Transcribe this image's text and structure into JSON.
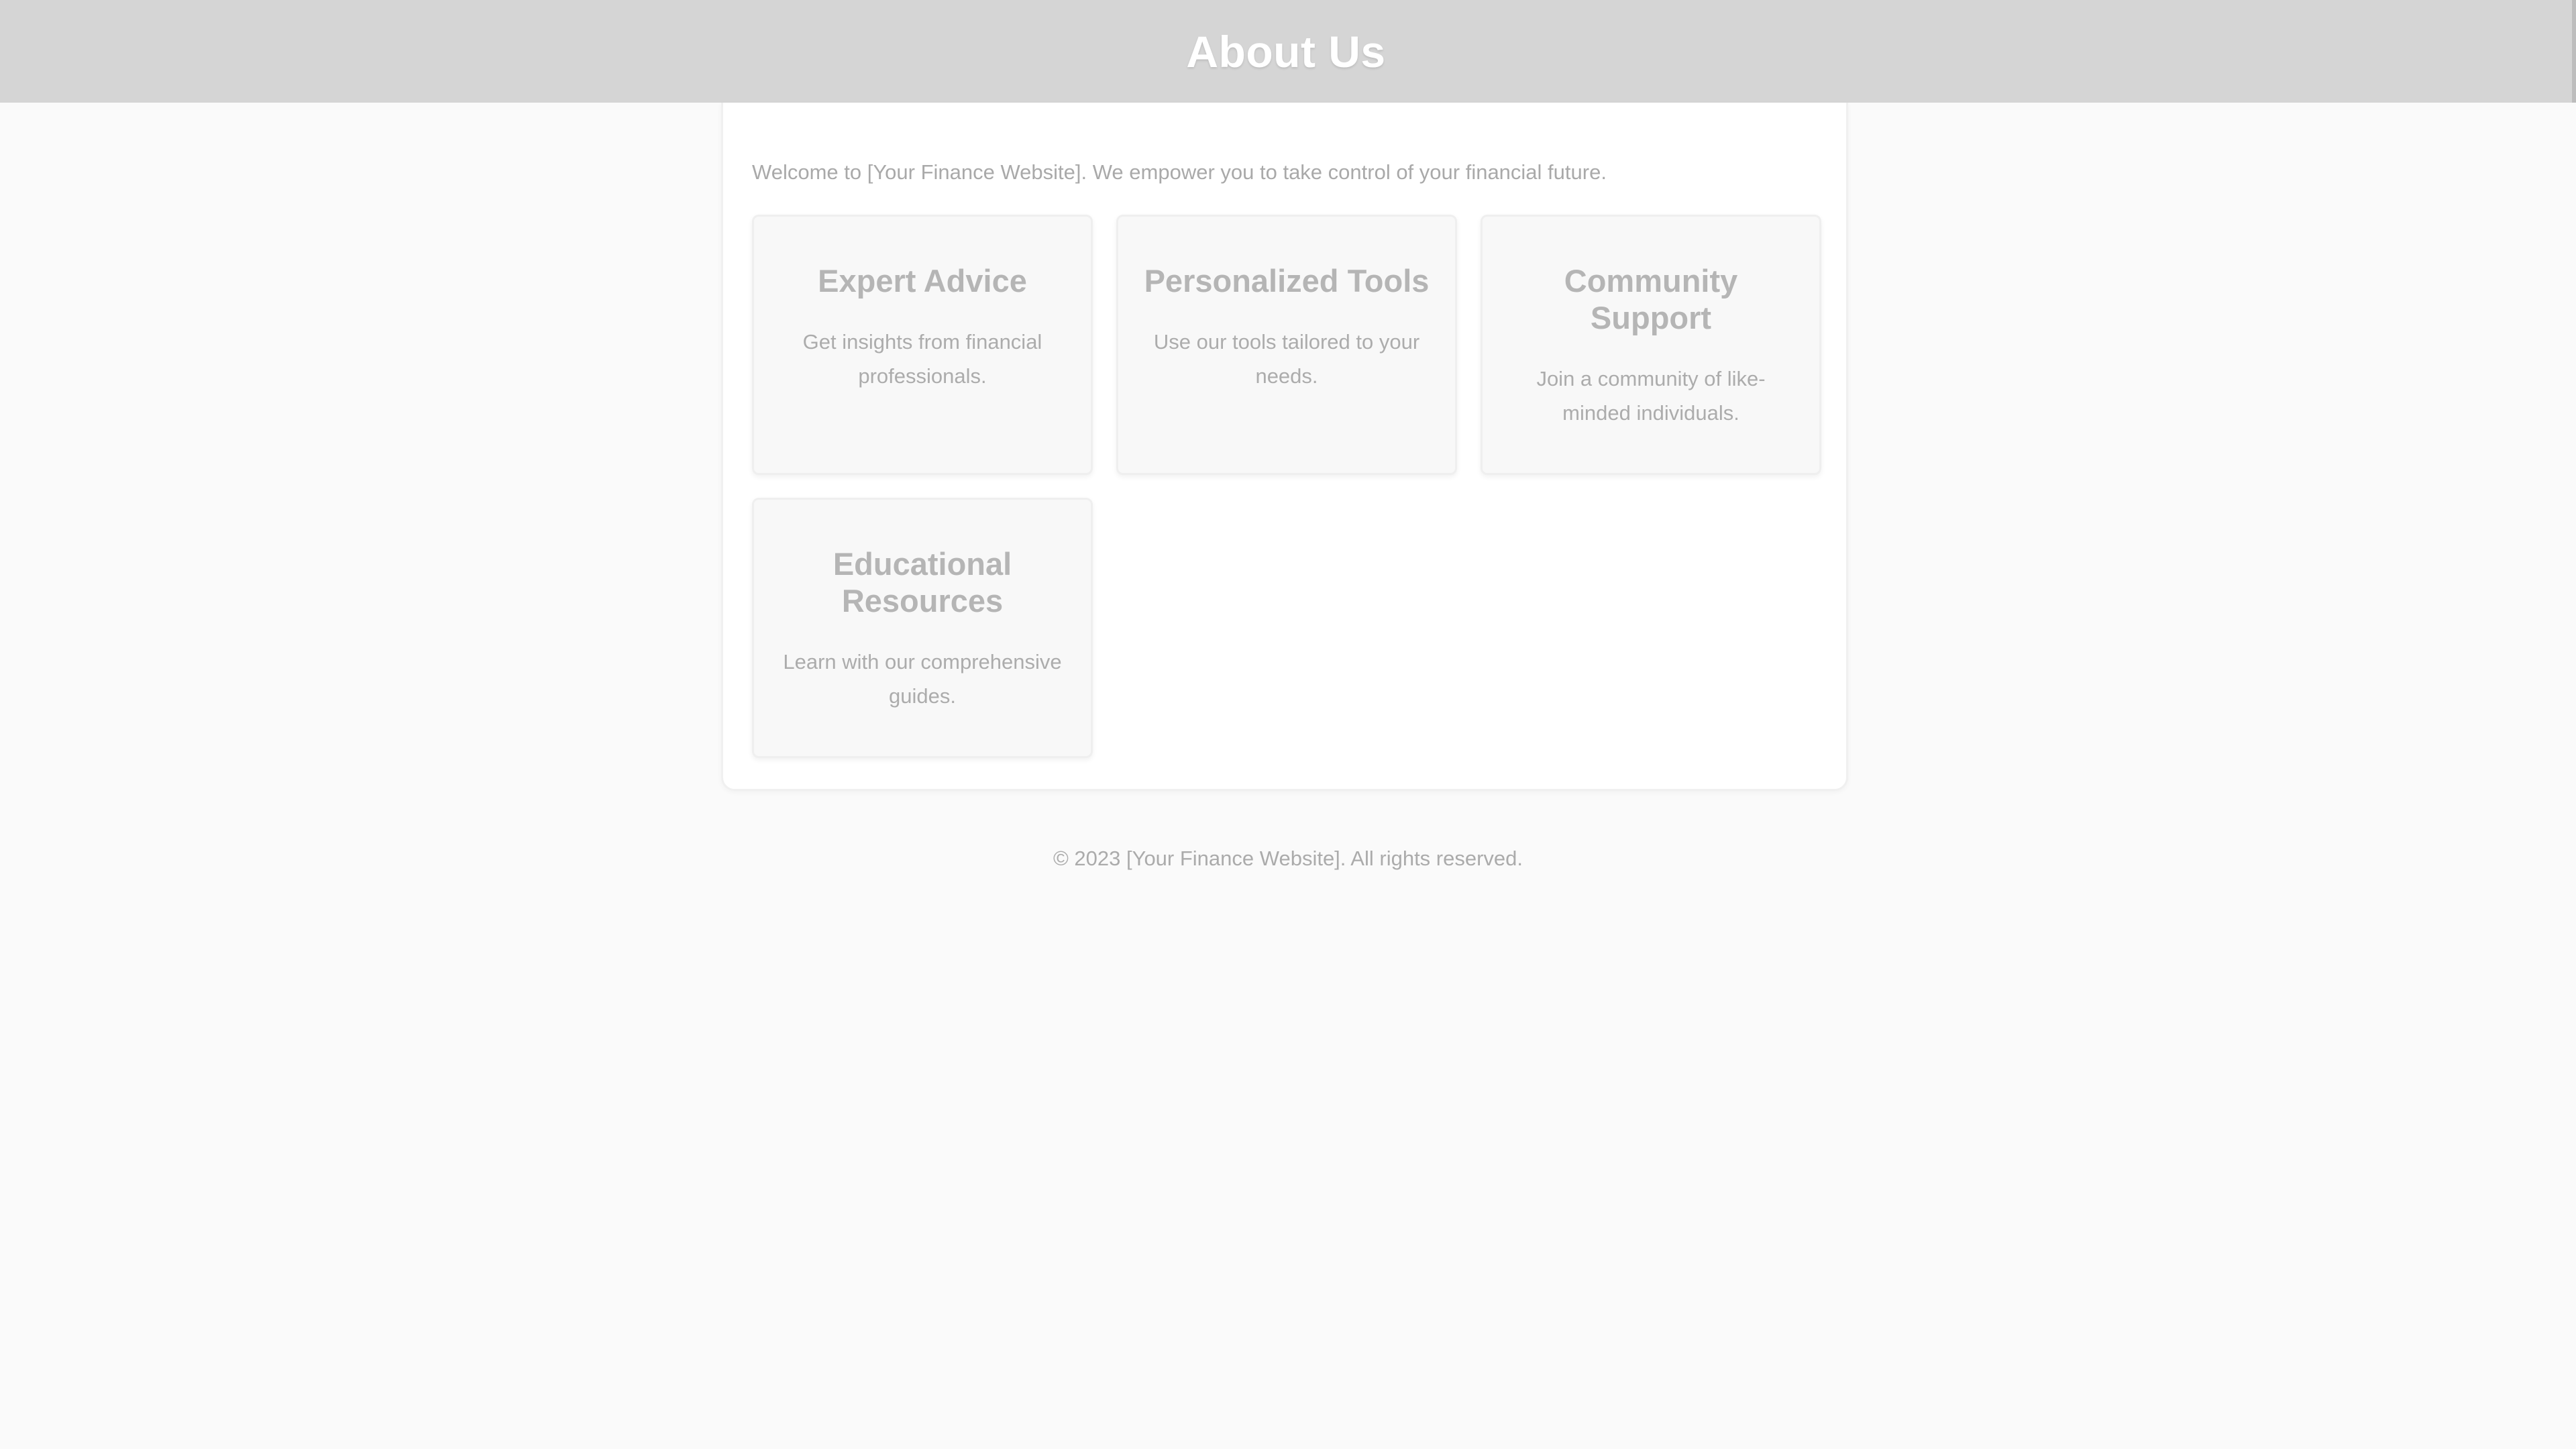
{
  "header": {
    "title": "About Us"
  },
  "main": {
    "intro": "Welcome to [Your Finance Website]. We empower you to take control of your financial future.",
    "cards": [
      {
        "title": "Expert Advice",
        "description": "Get insights from financial professionals."
      },
      {
        "title": "Personalized Tools",
        "description": "Use our tools tailored to your needs."
      },
      {
        "title": "Community Support",
        "description": "Join a community of like-minded individuals."
      },
      {
        "title": "Educational Resources",
        "description": "Learn with our comprehensive guides."
      }
    ]
  },
  "footer": {
    "copyright": "© 2023 [Your Finance Website]. All rights reserved."
  },
  "colors": {
    "header_bg": "#d5d5d5",
    "header_text": "#ffffff",
    "page_bg": "#fafafa",
    "card_bg": "#f8f8f8",
    "muted_text": "#a9a9a9"
  }
}
